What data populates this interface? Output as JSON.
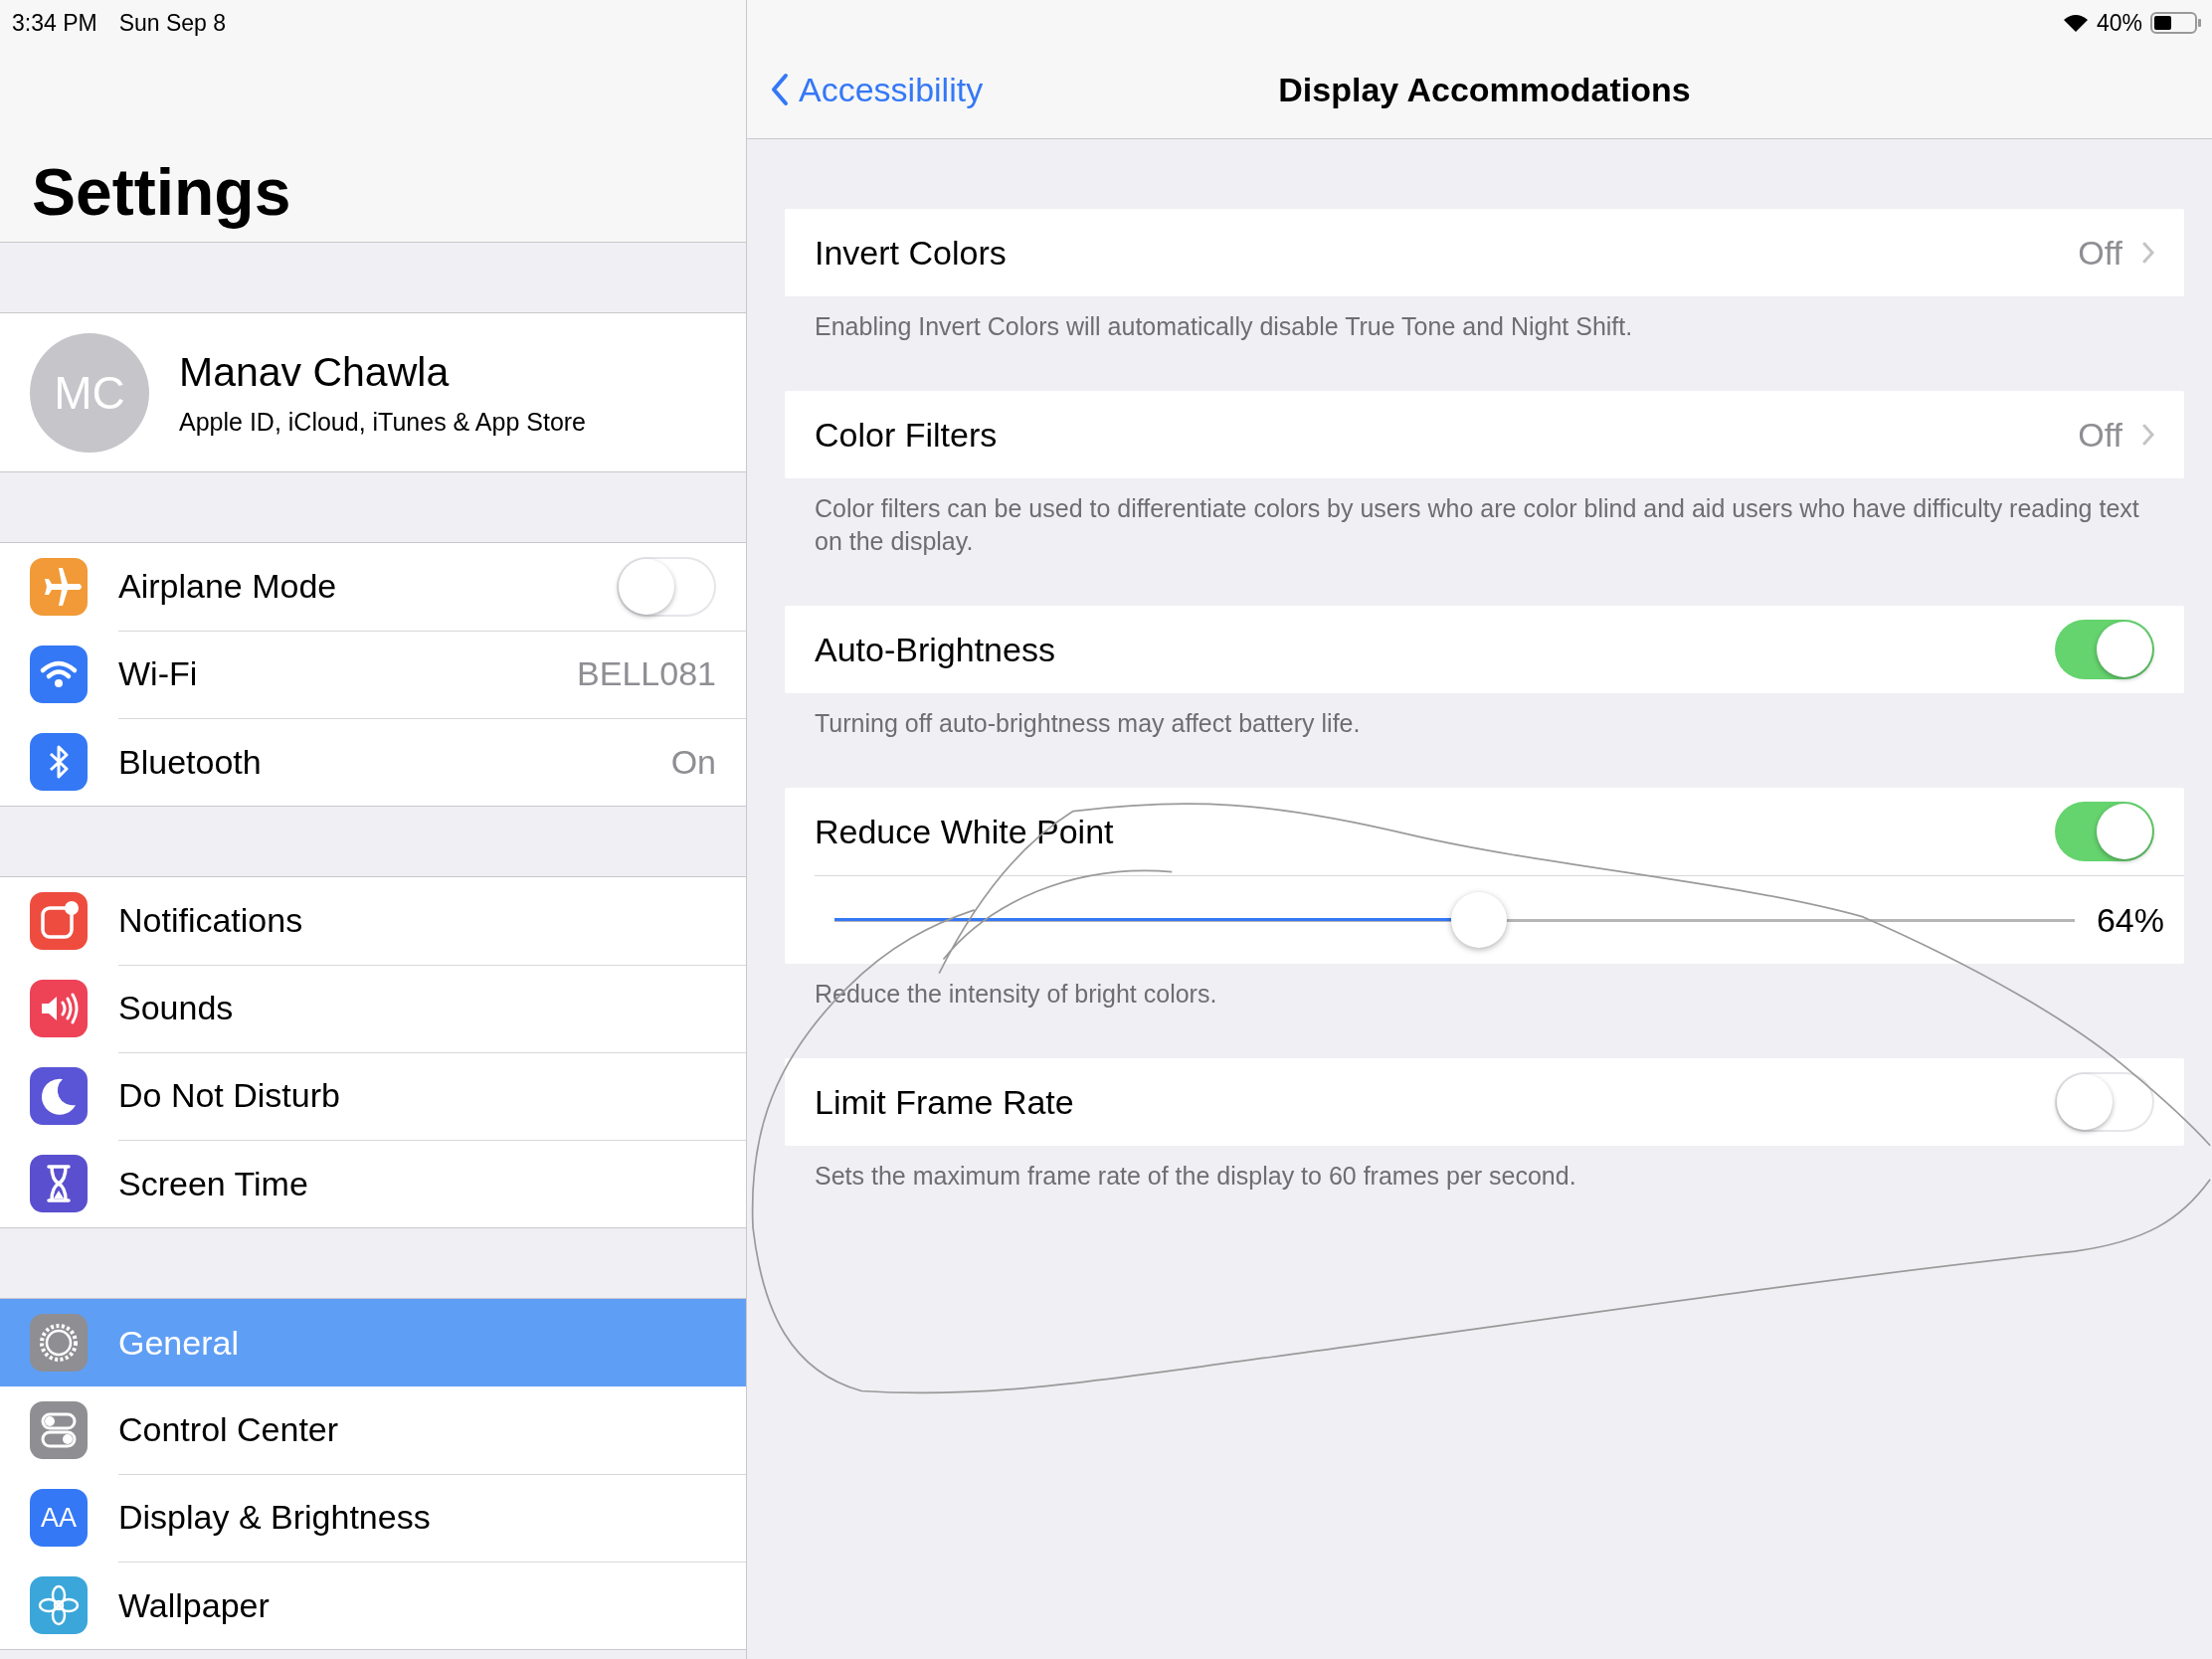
{
  "status_bar": {
    "time": "3:34 PM",
    "date": "Sun Sep 8",
    "battery": "40%"
  },
  "sidebar": {
    "title": "Settings",
    "profile": {
      "initials": "MC",
      "name": "Manav Chawla",
      "subtitle": "Apple ID, iCloud, iTunes & App Store"
    },
    "groups": [
      [
        {
          "label": "Airplane Mode",
          "kind": "toggle",
          "on": false,
          "color": "#f19a37",
          "selected": false
        },
        {
          "label": "Wi-Fi",
          "kind": "value",
          "value": "BELL081",
          "color": "#3478f6",
          "selected": false
        },
        {
          "label": "Bluetooth",
          "kind": "value",
          "value": "On",
          "color": "#3478f6",
          "selected": false
        }
      ],
      [
        {
          "label": "Notifications",
          "kind": "plain",
          "color": "#ee4c3f",
          "selected": false
        },
        {
          "label": "Sounds",
          "kind": "plain",
          "color": "#ee4257",
          "selected": false
        },
        {
          "label": "Do Not Disturb",
          "kind": "plain",
          "color": "#5a55d6",
          "selected": false
        },
        {
          "label": "Screen Time",
          "kind": "plain",
          "color": "#5a4fce",
          "selected": false
        }
      ],
      [
        {
          "label": "General",
          "kind": "plain",
          "color": "#8e8e93",
          "selected": true
        },
        {
          "label": "Control Center",
          "kind": "plain",
          "color": "#8e8e93",
          "selected": false
        },
        {
          "label": "Display & Brightness",
          "kind": "plain",
          "color": "#3478f6",
          "icon_text": "AA",
          "selected": false
        },
        {
          "label": "Wallpaper",
          "kind": "plain",
          "color": "#3ba6d9",
          "selected": false
        }
      ]
    ]
  },
  "nav": {
    "back": "Accessibility",
    "title": "Display Accommodations"
  },
  "sections": [
    {
      "label": "Invert Colors",
      "kind": "link",
      "value": "Off",
      "footer": "Enabling Invert Colors will automatically disable True Tone and Night Shift."
    },
    {
      "label": "Color Filters",
      "kind": "link",
      "value": "Off",
      "footer": "Color filters can be used to differentiate colors by users who are color blind and aid users who have difficulty reading text on the display."
    },
    {
      "label": "Auto-Brightness",
      "kind": "toggle",
      "on": true,
      "footer": "Turning off auto-brightness may affect battery life."
    },
    {
      "label": "Reduce White Point",
      "kind": "toggle",
      "on": true,
      "slider": {
        "level": 0.52,
        "reading": "64%"
      },
      "footer": "Reduce the intensity of bright colors."
    },
    {
      "label": "Limit Frame Rate",
      "kind": "toggle",
      "on": false,
      "footer": "Sets the maximum frame rate of the display to 60 frames per second."
    }
  ]
}
